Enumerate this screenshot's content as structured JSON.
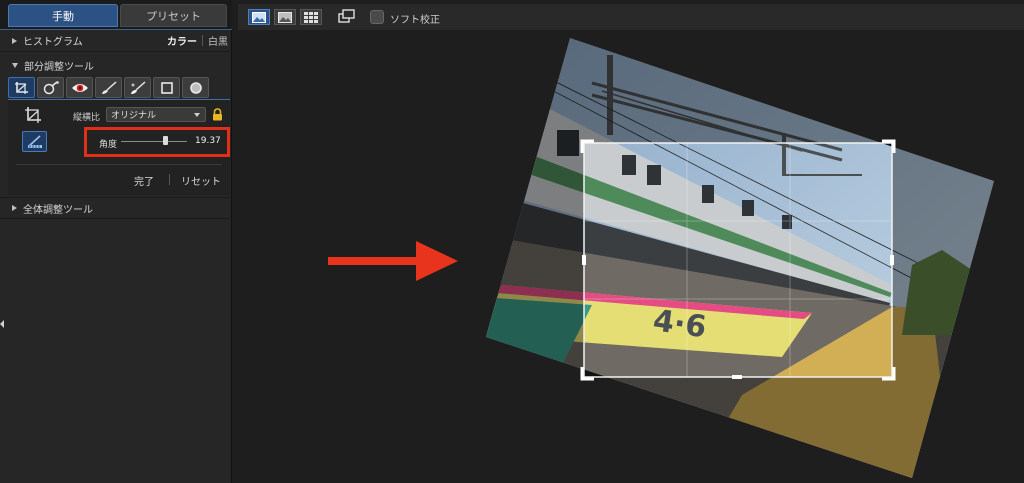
{
  "tabs": {
    "manual": "手動",
    "preset": "プリセット"
  },
  "histogram": {
    "label": "ヒストグラム",
    "color": "カラー",
    "mono": "白黒"
  },
  "local_tools": {
    "label": "部分調整ツール",
    "tools": [
      "crop-straighten-icon",
      "color-pick-icon",
      "red-eye-icon",
      "brush-icon",
      "eraser-brush-icon",
      "rect-mask-icon",
      "circle-mask-icon"
    ],
    "aspect_label": "縦横比",
    "aspect_value": "オリジナル",
    "angle_label": "角度",
    "angle_value": "19.37",
    "done_label": "完了",
    "reset_label": "リセット"
  },
  "global_tools": {
    "label": "全体調整ツール"
  },
  "toolbar": {
    "buttons": [
      "single-view-icon",
      "compare-view-icon",
      "grid-view-icon",
      "rotate-view-icon"
    ],
    "soft_label": "ソフト校正"
  },
  "colors": {
    "accent": "#2c5283",
    "highlight": "#e0301a",
    "arrow": "#e8341c"
  }
}
